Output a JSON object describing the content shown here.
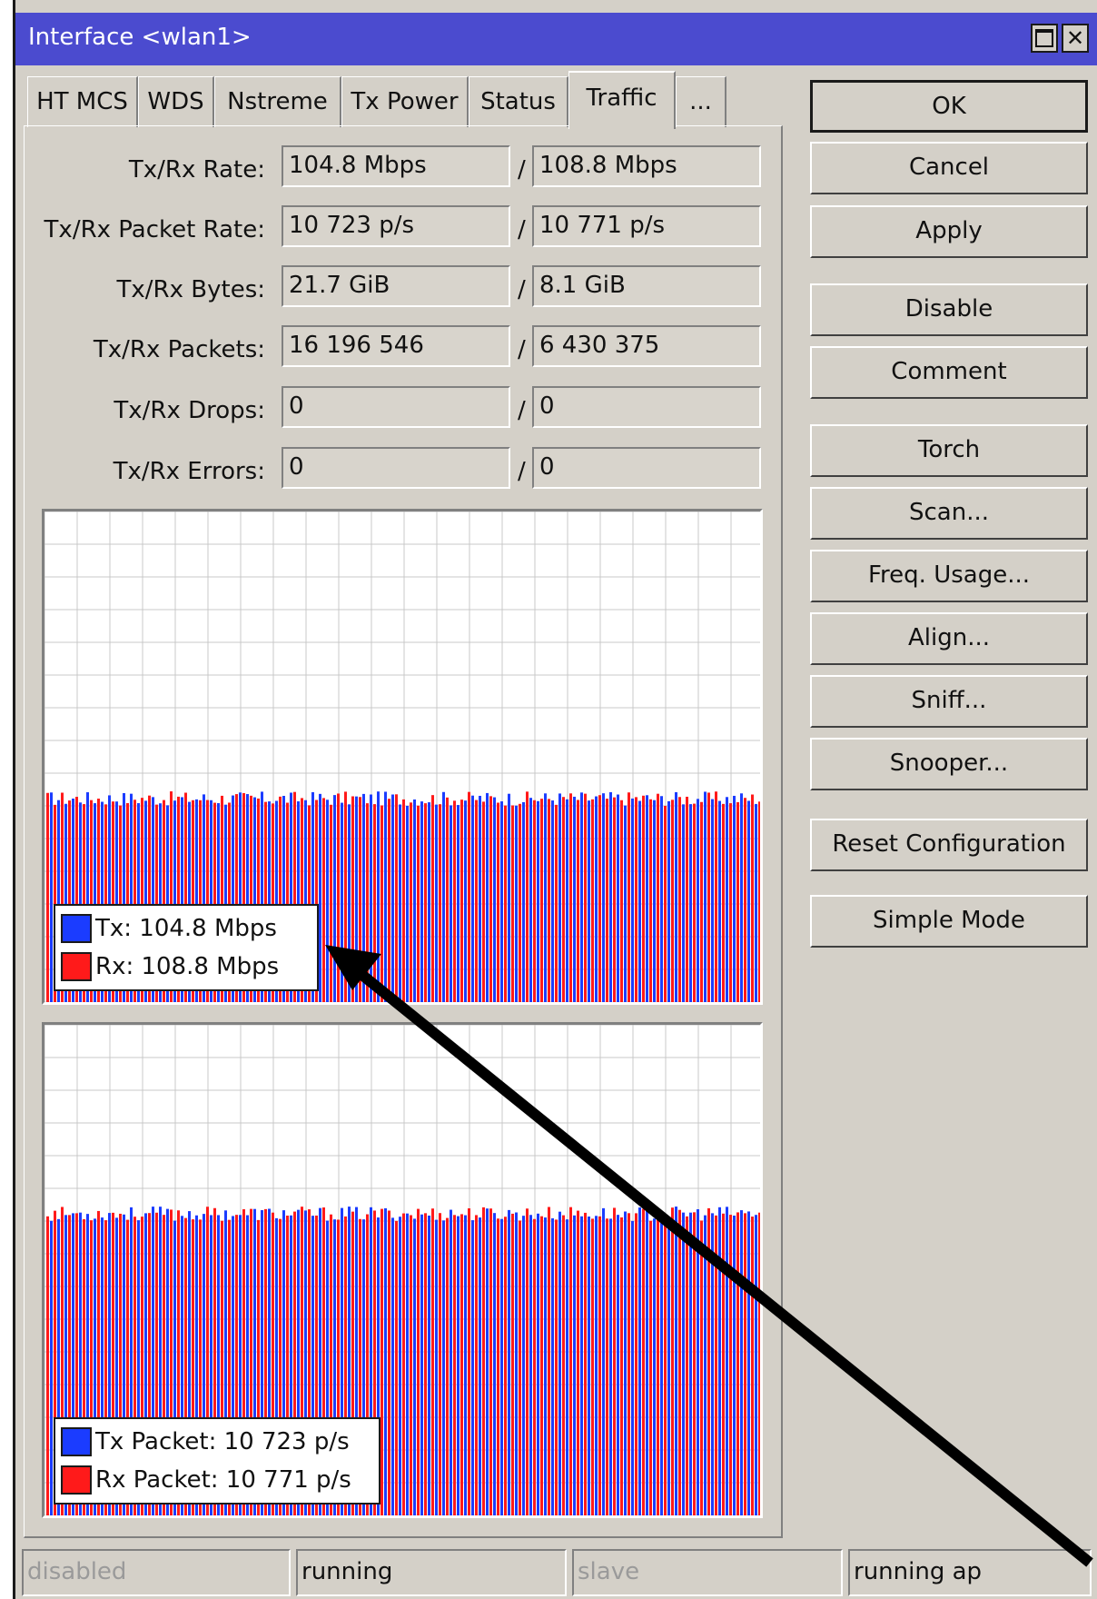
{
  "window": {
    "title": "Interface <wlan1>"
  },
  "tabs": [
    {
      "label": "HT MCS"
    },
    {
      "label": "WDS"
    },
    {
      "label": "Nstreme"
    },
    {
      "label": "Tx Power"
    },
    {
      "label": "Status"
    },
    {
      "label": "Traffic",
      "active": true
    },
    {
      "label": "..."
    }
  ],
  "fields": [
    {
      "label": "Tx/Rx Rate:",
      "tx": "104.8 Mbps",
      "rx": "108.8 Mbps"
    },
    {
      "label": "Tx/Rx Packet Rate:",
      "tx": "10 723 p/s",
      "rx": "10 771 p/s"
    },
    {
      "label": "Tx/Rx Bytes:",
      "tx": "21.7 GiB",
      "rx": "8.1 GiB"
    },
    {
      "label": "Tx/Rx Packets:",
      "tx": "16 196 546",
      "rx": "6 430 375"
    },
    {
      "label": "Tx/Rx Drops:",
      "tx": "0",
      "rx": "0"
    },
    {
      "label": "Tx/Rx Errors:",
      "tx": "0",
      "rx": "0"
    }
  ],
  "separator": "/",
  "buttons": {
    "ok": "OK",
    "cancel": "Cancel",
    "apply": "Apply",
    "disable": "Disable",
    "comment": "Comment",
    "torch": "Torch",
    "scan": "Scan...",
    "freq_usage": "Freq. Usage...",
    "align": "Align...",
    "sniff": "Sniff...",
    "snooper": "Snooper...",
    "reset": "Reset Configuration",
    "simple": "Simple Mode"
  },
  "graph_rate": {
    "legend_tx": "Tx:  104.8 Mbps",
    "legend_rx": "Rx:  108.8 Mbps",
    "level": 0.4,
    "tx_color": "#1b3cff",
    "rx_color": "#ff1a1a"
  },
  "graph_packets": {
    "legend_tx": "Tx Packet:  10 723 p/s",
    "legend_rx": "Rx Packet:  10 771 p/s",
    "level": 0.6,
    "tx_color": "#1b3cff",
    "rx_color": "#ff1a1a"
  },
  "status": [
    "disabled",
    "running",
    "slave",
    "running ap"
  ],
  "colors": {
    "titlebar": "#4b4bcf",
    "face": "#d4d0c8"
  }
}
